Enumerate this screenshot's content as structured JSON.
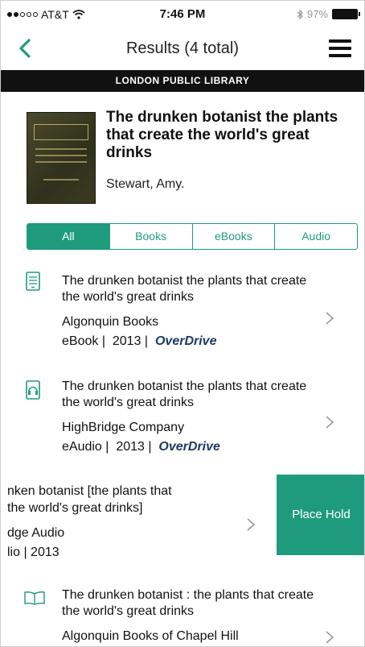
{
  "status_bar": {
    "carrier": "AT&T",
    "time": "7:46 PM",
    "battery": "97%"
  },
  "nav": {
    "title": "Results (4 total)"
  },
  "library_bar": "LONDON PUBLIC LIBRARY",
  "header": {
    "title": "The drunken botanist the plants that create the world's great drinks",
    "author": "Stewart, Amy."
  },
  "filters": [
    "All",
    "Books",
    "eBooks",
    "Audio"
  ],
  "results": [
    {
      "title": "The drunken botanist the plants that create the world's great drinks",
      "publisher": "Algonquin Books",
      "format": "eBook",
      "year": "2013",
      "source": "OverDrive",
      "icon": "ebook-icon"
    },
    {
      "title": "The drunken botanist the plants that create the world's great drinks",
      "publisher": "HighBridge Company",
      "format": "eAudio",
      "year": "2013",
      "source": "OverDrive",
      "icon": "eaudio-icon"
    },
    {
      "title_line1": "nken botanist [the plants that",
      "title_line2": "the world's great drinks]",
      "publisher": "dge Audio",
      "meta": "lio  |  2013",
      "action": "Place Hold"
    },
    {
      "title": "The drunken botanist : the plants that create the world's great drinks",
      "publisher": "Algonquin Books of Chapel Hill",
      "icon": "book-icon"
    }
  ],
  "colors": {
    "accent": "#1e9b7c",
    "library_bar": "#111111",
    "overdrive": "#1b3a64"
  }
}
